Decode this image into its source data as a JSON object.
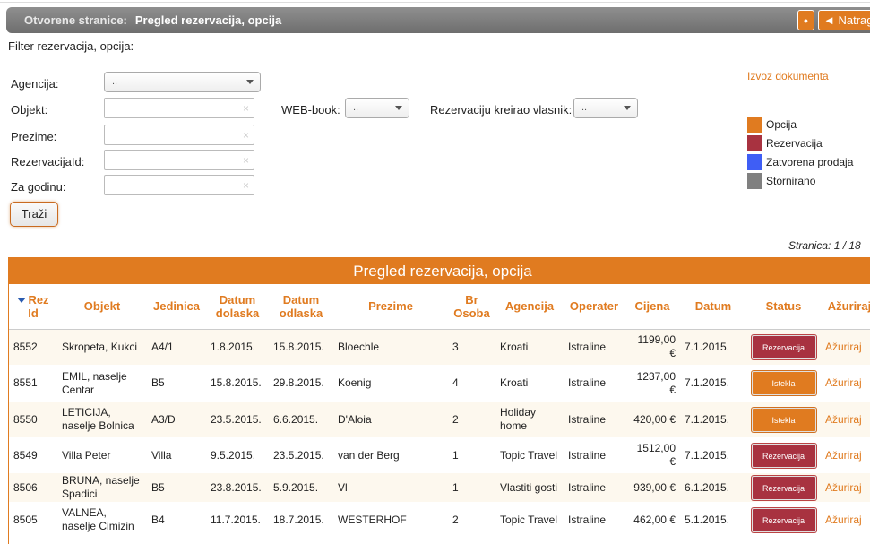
{
  "titlebar": {
    "label": "Otvorene stranice:",
    "title": "Pregled rezervacija, opcija",
    "small_btn": "●",
    "back_label": "◄ Natrag"
  },
  "filter": {
    "heading": "Filter rezervacija, opcija:",
    "agency_label": "Agencija:",
    "agency_value": "..",
    "object_label": "Objekt:",
    "object_value": "",
    "surname_label": "Prezime:",
    "surname_value": "",
    "resid_label": "RezervacijaId:",
    "resid_value": "",
    "year_label": "Za godinu:",
    "year_value": "",
    "webbook_label": "WEB-book:",
    "webbook_value": "..",
    "owner_label": "Rezervaciju kreirao vlasnik:",
    "owner_value": "..",
    "search_button": "Traži",
    "clear_glyph": "×"
  },
  "export": {
    "label": "Izvoz dokumenta"
  },
  "legend": [
    {
      "label": "Opcija",
      "color": "#e07b20"
    },
    {
      "label": "Rezervacija",
      "color": "#a83240"
    },
    {
      "label": "Zatvorena prodaja",
      "color": "#3f5ef5"
    },
    {
      "label": "Stornirano",
      "color": "#808080"
    }
  ],
  "pagination": {
    "text": "Stranica: 1 / 18"
  },
  "grid": {
    "title": "Pregled rezervacija, opcija",
    "columns": [
      "Rez Id",
      "Objekt",
      "Jedinica",
      "Datum dolaska",
      "Datum odlaska",
      "Prezime",
      "Br Osoba",
      "Agencija",
      "Operater",
      "Cijena",
      "Datum",
      "Status",
      "Ažuriraj"
    ],
    "rows": [
      {
        "id": "8552",
        "objekt": "Skropeta, Kukci",
        "jedinica": "A4/1",
        "dolazak": "1.8.2015.",
        "odlazak": "15.8.2015.",
        "prezime": "Bloechle",
        "osoba": "3",
        "agencija": "Kroati",
        "operater": "Istraline",
        "cijena": "1199,00 €",
        "datum": "7.1.2015.",
        "status": "Rezervacija",
        "update": "Ažuriraj"
      },
      {
        "id": "8551",
        "objekt": "EMIL, naselje Centar",
        "jedinica": "B5",
        "dolazak": "15.8.2015.",
        "odlazak": "29.8.2015.",
        "prezime": "Koenig",
        "osoba": "4",
        "agencija": "Kroati",
        "operater": "Istraline",
        "cijena": "1237,00 €",
        "datum": "7.1.2015.",
        "status": "Istekla",
        "update": "Ažuriraj"
      },
      {
        "id": "8550",
        "objekt": "LETICIJA, naselje Bolnica",
        "jedinica": "A3/D",
        "dolazak": "23.5.2015.",
        "odlazak": "6.6.2015.",
        "prezime": "D'Aloia",
        "osoba": "2",
        "agencija": "Holiday home",
        "operater": "Istraline",
        "cijena": "420,00 €",
        "datum": "7.1.2015.",
        "status": "Istekla",
        "update": "Ažuriraj"
      },
      {
        "id": "8549",
        "objekt": "Villa Peter",
        "jedinica": "Villa",
        "dolazak": "9.5.2015.",
        "odlazak": "23.5.2015.",
        "prezime": "van der Berg",
        "osoba": "1",
        "agencija": "Topic Travel",
        "operater": "Istraline",
        "cijena": "1512,00 €",
        "datum": "7.1.2015.",
        "status": "Rezervacija",
        "update": "Ažuriraj"
      },
      {
        "id": "8506",
        "objekt": "BRUNA, naselje Spadici",
        "jedinica": "B5",
        "dolazak": "23.8.2015.",
        "odlazak": "5.9.2015.",
        "prezime": "Vl",
        "osoba": "1",
        "agencija": "Vlastiti gosti",
        "operater": "Istraline",
        "cijena": "939,00 €",
        "datum": "6.1.2015.",
        "status": "Rezervacija",
        "update": "Ažuriraj"
      },
      {
        "id": "8505",
        "objekt": "VALNEA, naselje Cimizin",
        "jedinica": "B4",
        "dolazak": "11.7.2015.",
        "odlazak": "18.7.2015.",
        "prezime": "WESTERHOF",
        "osoba": "2",
        "agencija": "Topic Travel",
        "operater": "Istraline",
        "cijena": "462,00 €",
        "datum": "5.1.2015.",
        "status": "Rezervacija",
        "update": "Ažuriraj"
      }
    ]
  }
}
